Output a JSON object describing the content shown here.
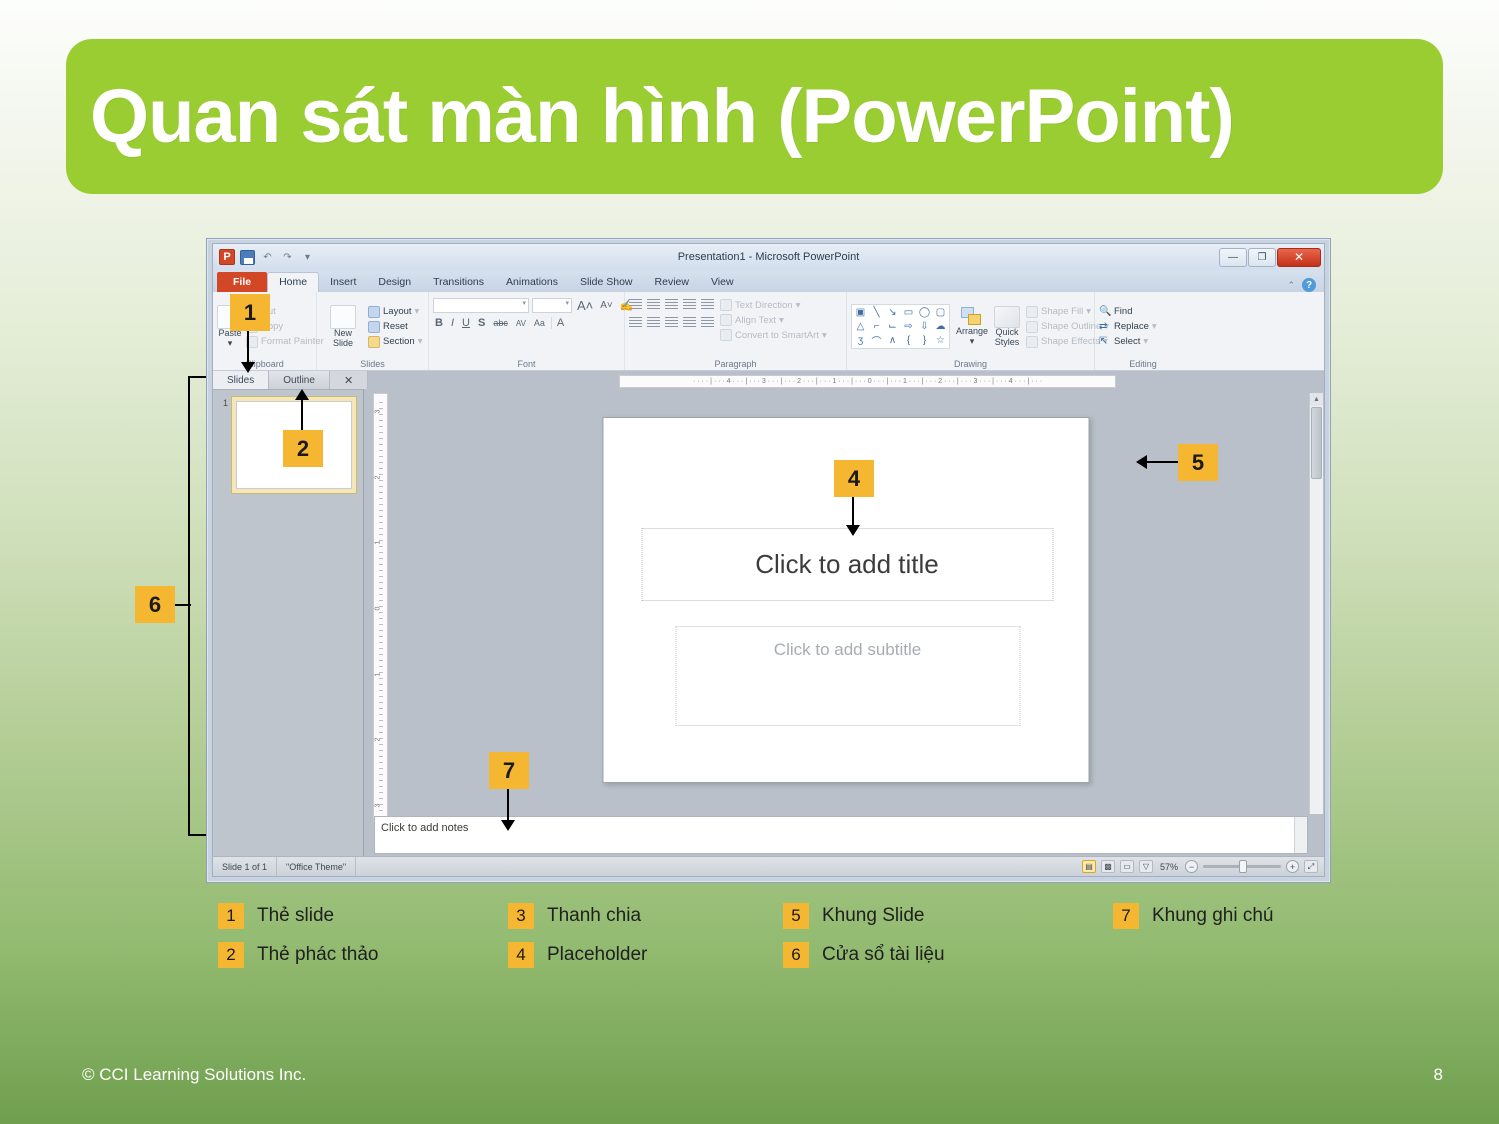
{
  "slide": {
    "title": "Quan sát màn hình (PowerPoint)",
    "footer_copyright": "© CCI Learning Solutions Inc.",
    "page_number": "8",
    "accent_green": "#9acd32",
    "callout_yellow": "#f5b731"
  },
  "ppt": {
    "titlebar": {
      "document_title": "Presentation1  -  Microsoft PowerPoint",
      "logo": "P",
      "qat": [
        "save-icon",
        "undo-icon",
        "redo-icon",
        "customize-qat-icon"
      ],
      "minimize": "—",
      "maximize": "❐",
      "close": "✕"
    },
    "tabs": [
      {
        "label": "File",
        "state": "file"
      },
      {
        "label": "Home",
        "state": "active"
      },
      {
        "label": "Insert",
        "state": "normal"
      },
      {
        "label": "Design",
        "state": "normal"
      },
      {
        "label": "Transitions",
        "state": "normal"
      },
      {
        "label": "Animations",
        "state": "normal"
      },
      {
        "label": "Slide Show",
        "state": "normal"
      },
      {
        "label": "Review",
        "state": "normal"
      },
      {
        "label": "View",
        "state": "normal"
      }
    ],
    "help_button": "?",
    "ribbon": {
      "clipboard": {
        "label": "Clipboard",
        "paste": "Paste",
        "cut": "Cut",
        "copy": "Copy",
        "format_painter": "Format Painter"
      },
      "slides": {
        "label": "Slides",
        "new_slide": "New\nSlide",
        "new_slide_l1": "New",
        "new_slide_l2": "Slide",
        "layout": "Layout",
        "reset": "Reset",
        "section": "Section"
      },
      "font": {
        "label": "Font",
        "font_name": "",
        "font_size": "",
        "grow": "A",
        "shrink": "A",
        "clear_formatting": "clear-format-icon",
        "bold": "B",
        "italic": "I",
        "underline": "U",
        "shadow": "S",
        "strikethrough": "abc",
        "character_spacing": "AV",
        "change_case": "Aa",
        "font_color": "A"
      },
      "paragraph": {
        "label": "Paragraph",
        "text_direction": "Text Direction",
        "align_text": "Align Text",
        "convert_to_smartart": "Convert to SmartArt"
      },
      "drawing": {
        "label": "Drawing",
        "arrange": "Arrange",
        "quick_styles_l1": "Quick",
        "quick_styles_l2": "Styles",
        "shape_fill": "Shape Fill",
        "shape_outline": "Shape Outline",
        "shape_effects": "Shape Effects"
      },
      "editing": {
        "label": "Editing",
        "find": "Find",
        "replace": "Replace",
        "select": "Select"
      }
    },
    "left_panel": {
      "tab_slides": "Slides",
      "tab_outline": "Outline",
      "close": "✕",
      "thumbnail_number": "1"
    },
    "ruler": {
      "horizontal": "· · · · | · · · 4 · · · | · · · 3 · · · | · · · 2 · · · | · · · 1 · · · | · · · 0 · · · | · · · 1 · · · | · · · 2 · · · | · · · 3 · · · | · · · 4 · · · | · · ·",
      "vertical_labels": [
        "3",
        "2",
        "1",
        "0",
        "1",
        "2",
        "3"
      ]
    },
    "slide_canvas": {
      "title_placeholder": "Click to add title",
      "subtitle_placeholder": "Click to add subtitle"
    },
    "notes": {
      "placeholder": "Click to add notes"
    },
    "statusbar": {
      "slide_count": "Slide 1 of 1",
      "theme": "\"Office Theme\"",
      "zoom_percent": "57%",
      "zoom_out": "−",
      "zoom_in": "+",
      "fit_to_window": "fit-slide-icon",
      "views": [
        "normal-view-icon",
        "slide-sorter-icon",
        "reading-view-icon",
        "slide-show-icon"
      ]
    }
  },
  "callouts": [
    {
      "number": "1"
    },
    {
      "number": "2"
    },
    {
      "number": "4"
    },
    {
      "number": "5"
    },
    {
      "number": "6"
    },
    {
      "number": "7"
    }
  ],
  "legend": {
    "columns": [
      [
        {
          "num": "1",
          "label": "Thẻ slide"
        },
        {
          "num": "2",
          "label": "Thẻ phác thảo"
        }
      ],
      [
        {
          "num": "3",
          "label": "Thanh chia"
        },
        {
          "num": "4",
          "label": "Placeholder"
        }
      ],
      [
        {
          "num": "5",
          "label": "Khung Slide"
        },
        {
          "num": "6",
          "label": "Cửa sổ tài liệu"
        }
      ],
      [
        {
          "num": "7",
          "label": "Khung ghi chú"
        }
      ]
    ]
  }
}
